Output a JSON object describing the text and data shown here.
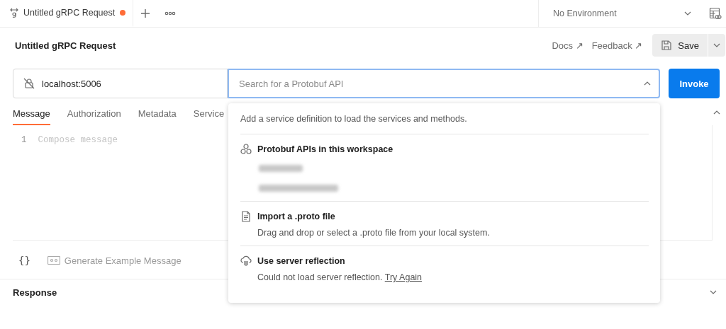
{
  "tab_bar": {
    "tabs": [
      {
        "label": "Untitled gRPC Request",
        "selected": true,
        "unsaved": true
      }
    ],
    "environment": "No Environment"
  },
  "request": {
    "title": "Untitled gRPC Request",
    "links": [
      "Docs ↗",
      "Feedback ↗"
    ],
    "save_label": "Save"
  },
  "url_bar": {
    "url": "localhost:5006",
    "method_search": {
      "placeholder": "Search for a Protobuf API"
    },
    "invoke_label": "Invoke"
  },
  "request_tabs": [
    {
      "label": "Message",
      "selected": true
    },
    {
      "label": "Authorization",
      "selected": false
    },
    {
      "label": "Metadata",
      "selected": false
    },
    {
      "label": "Service",
      "selected": false
    }
  ],
  "editor": {
    "line_number": "1",
    "placeholder": "Compose message"
  },
  "editor_footer": {
    "braces": "{}",
    "generate_label": "Generate Example Message"
  },
  "response": {
    "title": "Response"
  },
  "dropdown": {
    "intro": "Add a service definition to load the services and methods.",
    "sections": [
      {
        "kind": "apis",
        "title": "Protobuf APIs in this workspace",
        "items": [
          {
            "kind": "redacted"
          },
          {
            "kind": "redacted"
          }
        ]
      },
      {
        "kind": "file",
        "title": "Import a .proto file",
        "description": "Drag and drop or select a .proto file from your local system."
      },
      {
        "kind": "reflection",
        "title": "Use server reflection",
        "description": "Could not load server reflection.",
        "link": "Try Again"
      }
    ]
  }
}
